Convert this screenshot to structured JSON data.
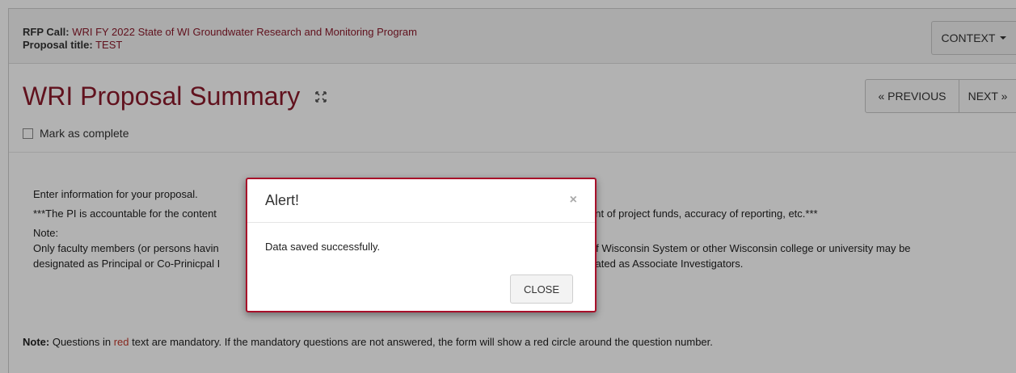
{
  "header": {
    "rfp_label": "RFP Call:",
    "rfp_value": "WRI FY 2022 State of WI Groundwater Research and Monitoring Program",
    "proposal_label": "Proposal title:",
    "proposal_value": "TEST",
    "context_label": "CONTEXT"
  },
  "page": {
    "title": "WRI Proposal Summary",
    "expand_icon": "expand-arrows-icon",
    "prev_label": "« PREVIOUS",
    "next_label": "NEXT »",
    "mark_complete_label": "Mark as complete"
  },
  "content": {
    "intro": "Enter information for your proposal.",
    "accountable_start": "***The PI is accountable for the content",
    "accountable_end": "ursement of project funds, accuracy of reporting, etc.***",
    "note_label": "Note:",
    "faculty_line1_start": "Only faculty members (or persons havin",
    "faculty_line1_end": "y of Wisconsin System or other Wisconsin college or university may be",
    "faculty_line2_start": "designated as Principal or Co-Prinicpal I",
    "faculty_line2_end": "designated as Associate Investigators."
  },
  "footer_note": {
    "label": "Note:",
    "text1": " Questions in ",
    "red_word": "red",
    "text2": " text are mandatory. If the mandatory questions are not answered, the form will show a red circle around the question number."
  },
  "modal": {
    "title": "Alert!",
    "close_symbol": "×",
    "message": "Data saved successfully.",
    "close_button": "CLOSE"
  },
  "colors": {
    "accent": "#8b1a2b",
    "modal_border": "#a8102a",
    "required_red": "#c0392b"
  }
}
